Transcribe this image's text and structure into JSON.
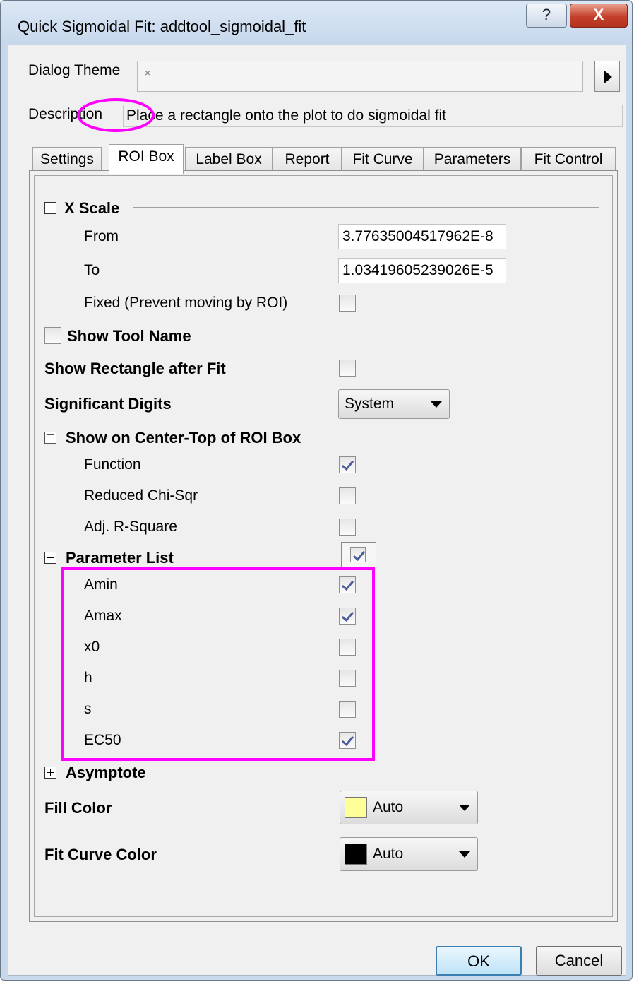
{
  "window": {
    "title": "Quick Sigmoidal Fit: addtool_sigmoidal_fit",
    "help_glyph": "?",
    "close_glyph": "X"
  },
  "header": {
    "dialog_theme_label": "Dialog Theme",
    "dialog_theme_value": "×",
    "description_label": "Description",
    "description_value": "Place a rectangle onto the plot to do sigmoidal fit"
  },
  "tabs": [
    {
      "label": "Settings"
    },
    {
      "label": "ROI Box"
    },
    {
      "label": "Label Box"
    },
    {
      "label": "Report"
    },
    {
      "label": "Fit Curve"
    },
    {
      "label": "Parameters"
    },
    {
      "label": "Fit Control"
    }
  ],
  "active_tab": "ROI Box",
  "x_scale": {
    "title": "X Scale",
    "from_label": "From",
    "from_value": "3.77635004517962E-8",
    "to_label": "To",
    "to_value": "1.03419605239026E-5",
    "fixed_label": "Fixed (Prevent moving by ROI)",
    "fixed_checked": false
  },
  "show_tool_name": {
    "label": "Show Tool Name",
    "checked": false
  },
  "show_rectangle": {
    "label": "Show Rectangle after Fit",
    "checked": false
  },
  "significant_digits": {
    "label": "Significant Digits",
    "value": "System"
  },
  "center_top": {
    "title": "Show on Center-Top of ROI Box",
    "items": [
      {
        "label": "Function",
        "checked": true
      },
      {
        "label": "Reduced Chi-Sqr",
        "checked": false
      },
      {
        "label": "Adj. R-Square",
        "checked": false
      }
    ]
  },
  "parameter_list": {
    "title": "Parameter List",
    "header_checked": true,
    "items": [
      {
        "label": "Amin",
        "checked": true
      },
      {
        "label": "Amax",
        "checked": true
      },
      {
        "label": "x0",
        "checked": false
      },
      {
        "label": "h",
        "checked": false
      },
      {
        "label": "s",
        "checked": false
      },
      {
        "label": "EC50",
        "checked": true
      }
    ]
  },
  "asymptote": {
    "title": "Asymptote"
  },
  "fill_color": {
    "label": "Fill Color",
    "value": "Auto",
    "swatch": "#ffff99"
  },
  "fit_curve_color": {
    "label": "Fit Curve Color",
    "value": "Auto",
    "swatch": "#000000"
  },
  "footer": {
    "ok_label": "OK",
    "cancel_label": "Cancel"
  },
  "colors": {
    "highlight": "#ff00ff",
    "check": "#4a5d9a"
  }
}
